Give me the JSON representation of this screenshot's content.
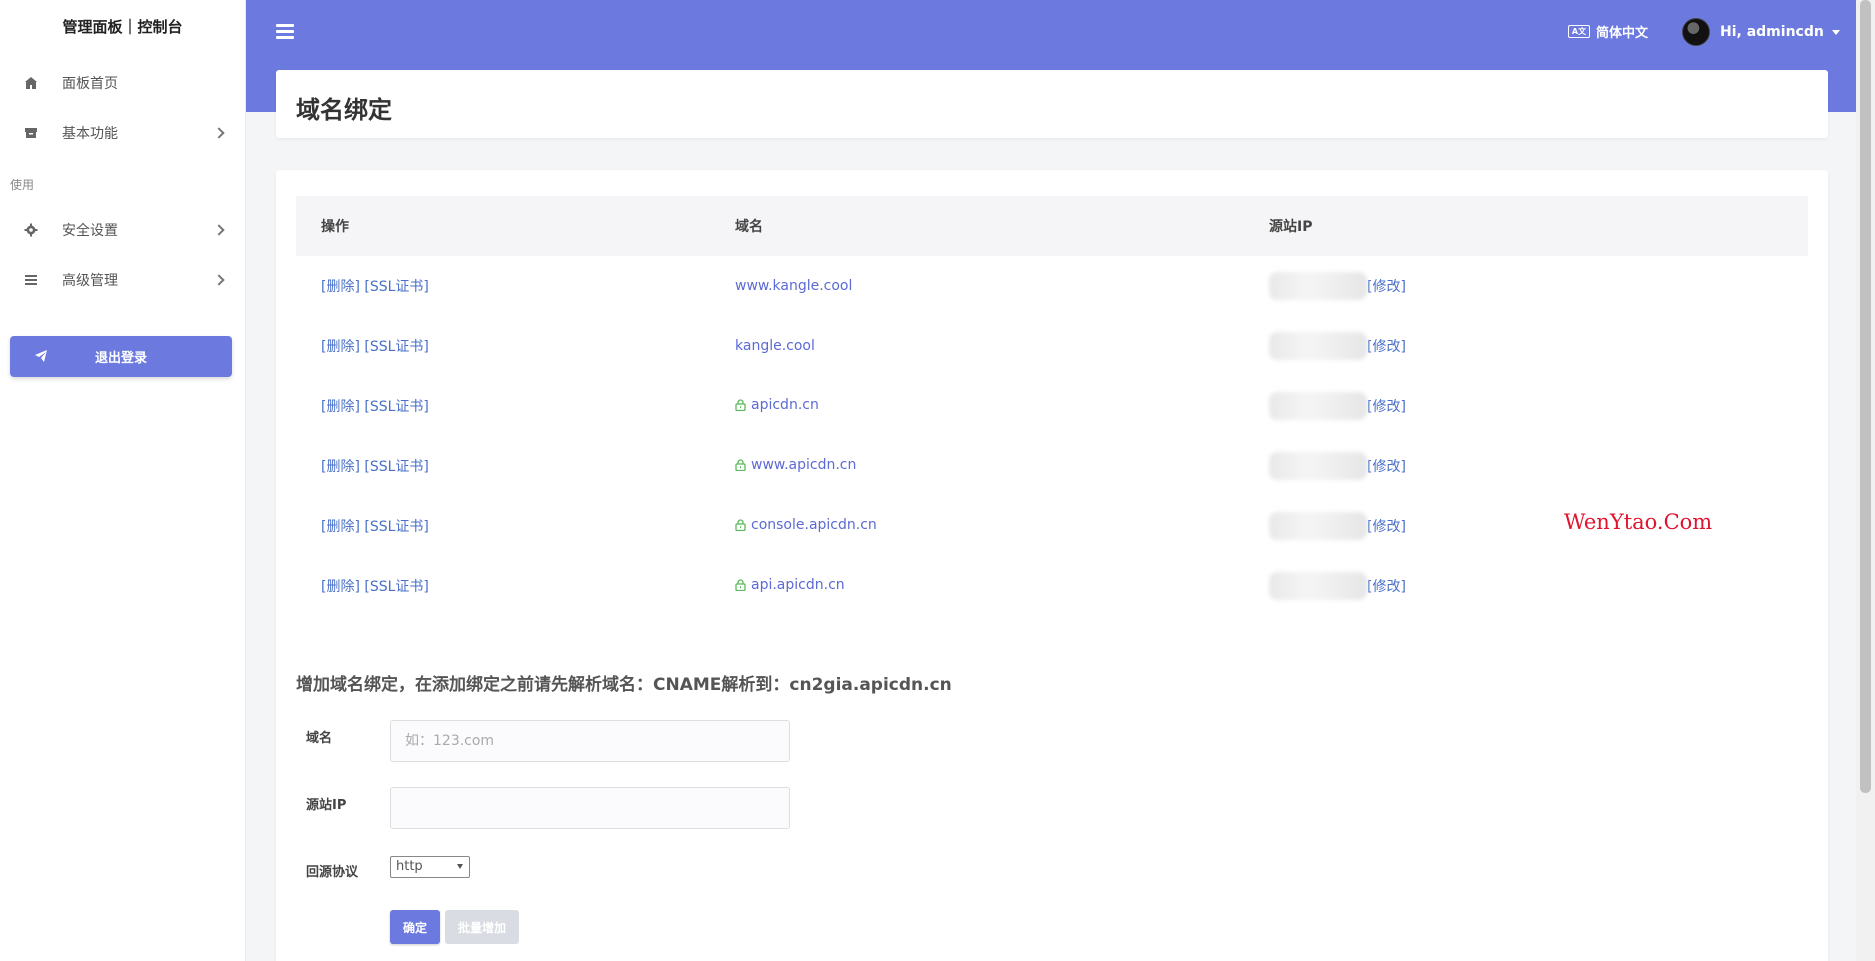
{
  "sidebar": {
    "brand": "管理面板｜控制台",
    "items": [
      {
        "label": "面板首页"
      },
      {
        "label": "基本功能"
      },
      {
        "label": "安全设置"
      },
      {
        "label": "高级管理"
      }
    ],
    "section_label": "使用",
    "logout_label": "退出登录"
  },
  "topbar": {
    "language": "简体中文",
    "language_icon_text": "A文",
    "user_greeting": "Hi, admincdn"
  },
  "page": {
    "title": "域名绑定"
  },
  "table": {
    "headers": [
      "操作",
      "域名",
      "源站IP"
    ],
    "delete_label": "[删除]",
    "ssl_label": "[SSL证书]",
    "edit_label": "[修改]",
    "rows": [
      {
        "domain": "www.kangle.cool",
        "ssl": false
      },
      {
        "domain": "kangle.cool",
        "ssl": false
      },
      {
        "domain": "apicdn.cn",
        "ssl": true
      },
      {
        "domain": "www.apicdn.cn",
        "ssl": true
      },
      {
        "domain": "console.apicdn.cn",
        "ssl": true
      },
      {
        "domain": "api.apicdn.cn",
        "ssl": true
      }
    ]
  },
  "add_form": {
    "title": "增加域名绑定，在添加绑定之前请先解析域名：CNAME解析到：cn2gia.apicdn.cn",
    "domain_label": "域名",
    "domain_placeholder": "如：123.com",
    "ip_label": "源站IP",
    "ip_value": "",
    "protocol_label": "回源协议",
    "protocol_value": "http",
    "ok_label": "确定",
    "batch_label": "批量增加"
  },
  "watermark": "WenYtao.Com",
  "colors": {
    "accent": "#6c7ae0",
    "link": "#4a70c8",
    "lock": "#5cb85c"
  }
}
